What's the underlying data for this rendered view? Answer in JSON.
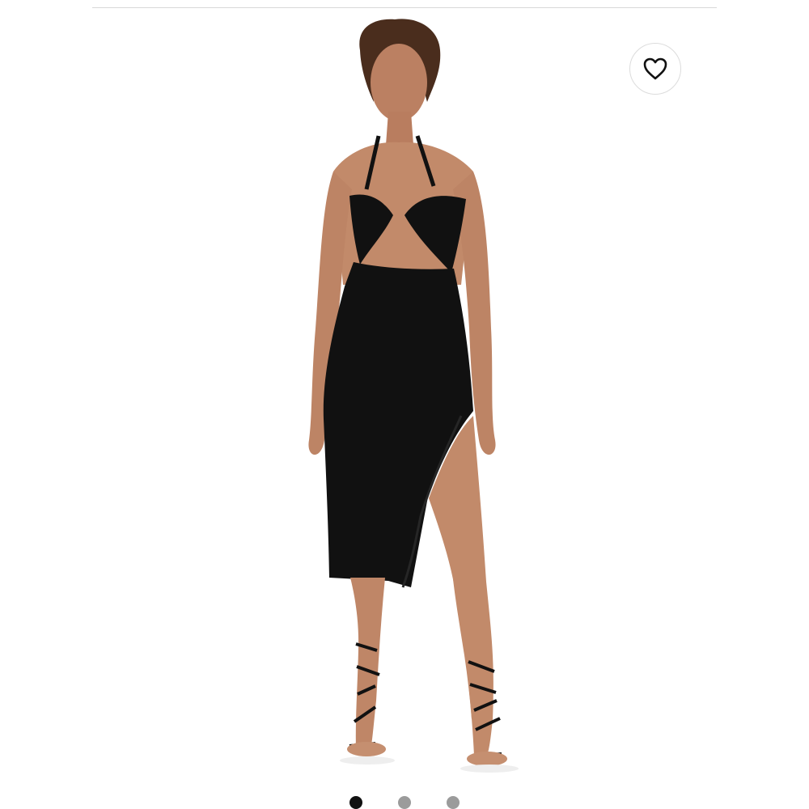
{
  "product": {
    "favorite_icon": "heart-outline-icon",
    "image_subject": "model-in-black-cutout-midi-dress"
  },
  "carousel": {
    "dots": [
      {
        "state": "active"
      },
      {
        "state": "inactive"
      },
      {
        "state": "inactive"
      }
    ]
  },
  "colors": {
    "background": "#ffffff",
    "divider": "#d8d8d8",
    "dress": "#111111",
    "active_dot": "#111111",
    "inactive_dot": "#9b9b9b"
  }
}
